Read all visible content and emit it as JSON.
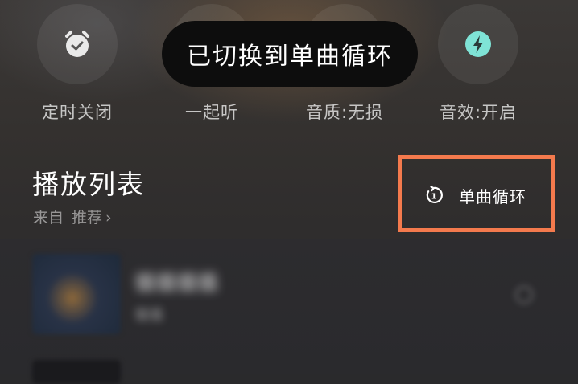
{
  "actions": [
    {
      "label": "定时关闭",
      "icon": "alarm-clock-icon"
    },
    {
      "label": "一起听",
      "icon": "listen-together-icon"
    },
    {
      "label": "音质:无损",
      "icon": "sound-quality-icon"
    },
    {
      "label": "音效:开启",
      "icon": "lightning-icon"
    }
  ],
  "toast": {
    "message": "已切换到单曲循环"
  },
  "playlist": {
    "title": "播放列表",
    "source_prefix": "来自",
    "source_name": "推荐",
    "source_chevron": "›",
    "mode_label": "单曲循环",
    "mode_icon": "repeat-one-icon"
  },
  "song": {
    "name": "循循循循",
    "artist": "循循",
    "more_icon": "more-icon"
  },
  "colors": {
    "highlight": "#f47a4d",
    "effect_icon": "#7fe3d6",
    "toast_bg": "#0d0d0d"
  }
}
